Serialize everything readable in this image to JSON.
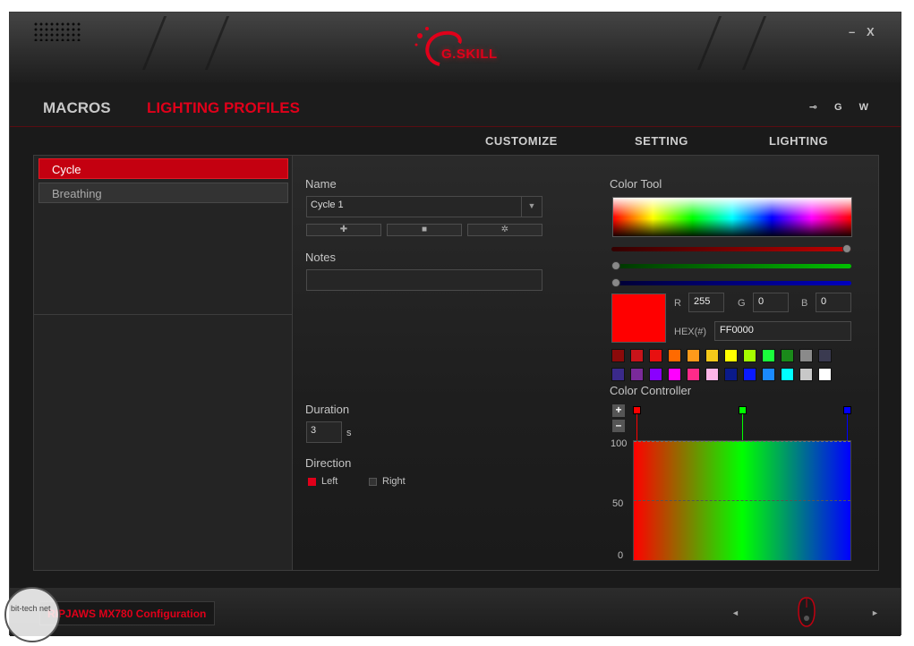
{
  "window": {
    "brand": "G.SKILL",
    "minimize_label": "–",
    "close_label": "X"
  },
  "nav": {
    "macros": "MACROS",
    "lighting_profiles": "LIGHTING PROFILES",
    "icons": "⊸ G W"
  },
  "subnav": {
    "customize": "CUSTOMIZE",
    "setting": "SETTING",
    "lighting": "LIGHTING"
  },
  "profiles": [
    {
      "label": "Cycle",
      "active": true
    },
    {
      "label": "Breathing",
      "active": false
    }
  ],
  "editor": {
    "name_label": "Name",
    "name_value": "Cycle 1",
    "dropdown_arrow": "▼",
    "add_symbol": "✚",
    "delete_symbol": "■",
    "settings_symbol": "✲",
    "notes_label": "Notes",
    "notes_value": "",
    "duration_label": "Duration",
    "duration_value": "3",
    "duration_unit": "s",
    "direction_label": "Direction",
    "direction_left": "Left",
    "direction_right": "Right",
    "direction_selected": "Left"
  },
  "color_tool": {
    "title": "Color Tool",
    "r_label": "R",
    "r_value": "255",
    "g_label": "G",
    "g_value": "0",
    "b_label": "B",
    "b_value": "0",
    "hex_label": "HEX(#)",
    "hex_value": "FF0000",
    "current_color": "#ff0000",
    "swatches_row1": [
      "#8b0a0a",
      "#c8141a",
      "#e81010",
      "#ff6a00",
      "#ff9a1a",
      "#f5c91a",
      "#ffff00",
      "#a6ff00",
      "#1aff3c",
      "#1a8a1a",
      "#8a8a8a",
      "#3a3a50"
    ],
    "swatches_row2": [
      "#3a2a8a",
      "#7a2a9a",
      "#8a00ff",
      "#ff00ff",
      "#ff2a8a",
      "#ffb6e8",
      "#0a1a8a",
      "#0a1aff",
      "#1a8aff",
      "#00ffff",
      "#c8c8c8",
      "#ffffff"
    ]
  },
  "color_controller": {
    "title": "Color Controller",
    "plus": "+",
    "minus": "–",
    "y_100": "100",
    "y_50": "50",
    "y_0": "0",
    "stops": [
      {
        "color": "#ff0000",
        "position": 0
      },
      {
        "color": "#00ff00",
        "position": 0.5
      },
      {
        "color": "#0000ff",
        "position": 1
      }
    ]
  },
  "footer": {
    "config_label": "RIPJAWS MX780 Configuration",
    "prev_arrow": "◄",
    "next_arrow": "►"
  },
  "watermark": {
    "text": "bit-tech net"
  }
}
